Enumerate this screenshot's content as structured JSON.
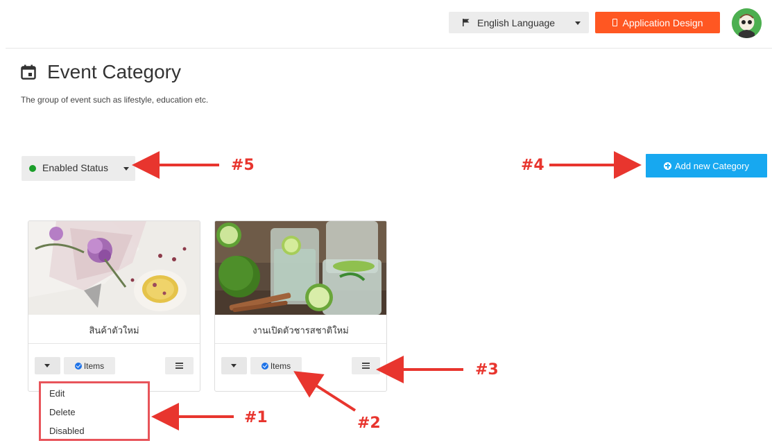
{
  "header": {
    "language_label": "English Language",
    "app_design_label": "Application Design"
  },
  "page": {
    "title": "Event Category",
    "subtitle": "The group of event such as lifestyle, education etc."
  },
  "toolbar": {
    "status_label": "Enabled Status",
    "add_label": "Add new Category"
  },
  "cards": [
    {
      "title": "สินค้าตัวใหม่",
      "items_label": "Items"
    },
    {
      "title": "งานเปิดตัวชารสชาติใหม่",
      "items_label": "Items"
    }
  ],
  "dropdown": {
    "items": [
      "Edit",
      "Delete",
      "Disabled"
    ]
  },
  "annotations": {
    "n1": "#1",
    "n2": "#2",
    "n3": "#3",
    "n4": "#4",
    "n5": "#5"
  },
  "colors": {
    "accent_orange": "#ff5722",
    "accent_blue": "#17a8f0",
    "status_green": "#1b9e2a",
    "annotation_red": "#e8352e"
  }
}
